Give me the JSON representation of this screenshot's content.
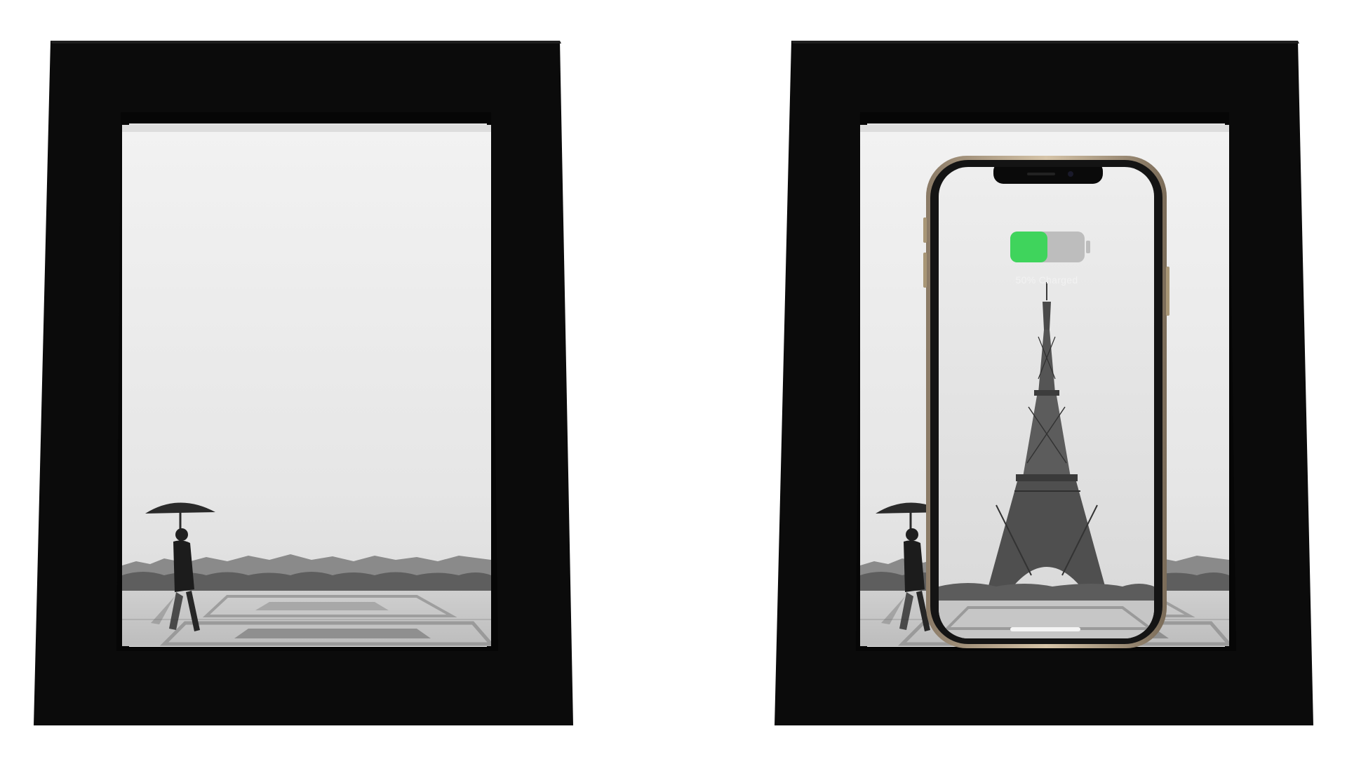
{
  "scene": {
    "frames": [
      {
        "variant": "photo-only"
      },
      {
        "variant": "with-phone"
      }
    ],
    "phone": {
      "battery_percent": 50,
      "battery_label": "50% Charged",
      "battery_fill_color": "#3fd45c",
      "battery_empty_color": "#bdbdbd"
    }
  }
}
